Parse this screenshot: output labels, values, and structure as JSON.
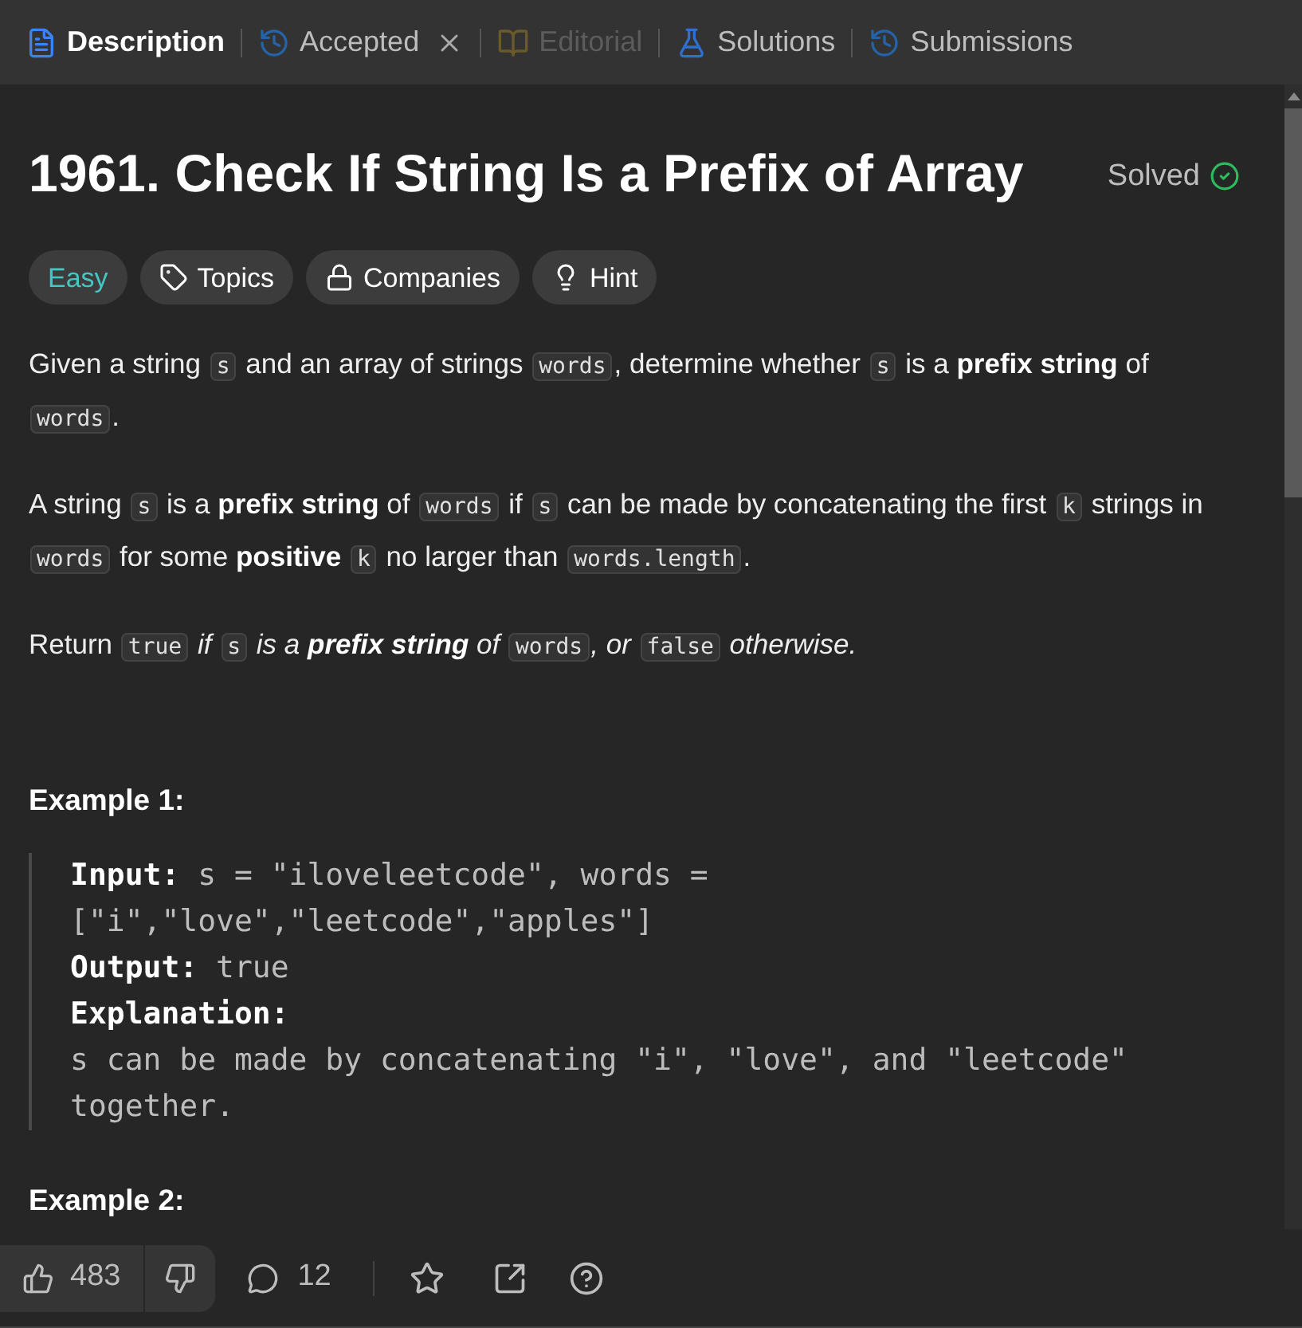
{
  "tabs": [
    {
      "label": "Description",
      "selected": true,
      "closable": false,
      "disabled": false
    },
    {
      "label": "Accepted",
      "selected": false,
      "closable": true,
      "disabled": false
    },
    {
      "label": "Editorial",
      "selected": false,
      "closable": false,
      "disabled": true
    },
    {
      "label": "Solutions",
      "selected": false,
      "closable": false,
      "disabled": false
    },
    {
      "label": "Submissions",
      "selected": false,
      "closable": false,
      "disabled": false
    }
  ],
  "problem": {
    "title": "1961. Check If String Is a Prefix of Array",
    "status": "Solved",
    "solved": true
  },
  "tags": [
    {
      "label": "Easy",
      "kind": "difficulty"
    },
    {
      "label": "Topics",
      "kind": "topics"
    },
    {
      "label": "Companies",
      "kind": "companies"
    },
    {
      "label": "Hint",
      "kind": "hint"
    }
  ],
  "paragraphs": [
    [
      {
        "kind": "text",
        "text": "Given a string "
      },
      {
        "kind": "code",
        "text": "s"
      },
      {
        "kind": "text",
        "text": " and an array of strings "
      },
      {
        "kind": "code",
        "text": "words"
      },
      {
        "kind": "text",
        "text": ", determine whether "
      },
      {
        "kind": "code",
        "text": "s"
      },
      {
        "kind": "text",
        "text": " is a "
      },
      {
        "kind": "bold",
        "text": "prefix string"
      },
      {
        "kind": "text",
        "text": " of "
      },
      {
        "kind": "code",
        "text": "words"
      },
      {
        "kind": "text",
        "text": "."
      }
    ],
    [
      {
        "kind": "text",
        "text": "A string "
      },
      {
        "kind": "code",
        "text": "s"
      },
      {
        "kind": "text",
        "text": " is a "
      },
      {
        "kind": "bold",
        "text": "prefix string"
      },
      {
        "kind": "text",
        "text": " of "
      },
      {
        "kind": "code",
        "text": "words"
      },
      {
        "kind": "text",
        "text": " if "
      },
      {
        "kind": "code",
        "text": "s"
      },
      {
        "kind": "text",
        "text": " can be made by concatenating the first "
      },
      {
        "kind": "code",
        "text": "k"
      },
      {
        "kind": "text",
        "text": " strings in "
      },
      {
        "kind": "code",
        "text": "words"
      },
      {
        "kind": "text",
        "text": " for some "
      },
      {
        "kind": "bold",
        "text": "positive "
      },
      {
        "kind": "code",
        "text": "k"
      },
      {
        "kind": "text",
        "text": " no larger than "
      },
      {
        "kind": "code",
        "text": "words.length"
      },
      {
        "kind": "text",
        "text": "."
      }
    ],
    [
      {
        "kind": "text",
        "text": "Return "
      },
      {
        "kind": "code",
        "text": "true"
      },
      {
        "kind": "italic",
        "text": " if "
      },
      {
        "kind": "code",
        "text": "s"
      },
      {
        "kind": "italic",
        "text": " is a "
      },
      {
        "kind": "bold_italic",
        "text": "prefix string"
      },
      {
        "kind": "italic",
        "text": " of "
      },
      {
        "kind": "code",
        "text": "words"
      },
      {
        "kind": "italic",
        "text": ", or "
      },
      {
        "kind": "code",
        "text": "false"
      },
      {
        "kind": "italic",
        "text": " otherwise."
      }
    ]
  ],
  "examples": [
    {
      "title": "Example 1:",
      "lines": [
        {
          "label": "Input:",
          "value": "s = \"iloveleetcode\", words = [\"i\",\"love\",\"leetcode\",\"apples\"]",
          "kind": "inline"
        },
        {
          "label": "Output:",
          "value": "true",
          "kind": "inline"
        },
        {
          "label": "Explanation:",
          "value": "s can be made by concatenating \"i\", \"love\", and \"leetcode\" together.",
          "kind": "block"
        }
      ]
    },
    {
      "title": "Example 2:"
    }
  ],
  "footer": {
    "likes": "483",
    "comments": "12"
  }
}
